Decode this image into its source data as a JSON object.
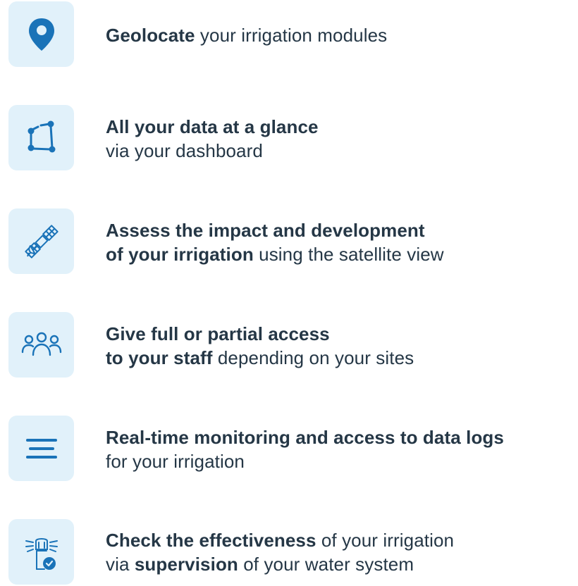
{
  "features": [
    {
      "icon": "location-pin-icon",
      "line1_bold": "Geolocate",
      "line1_rest": " your irrigation modules"
    },
    {
      "icon": "dashboard-nodes-icon",
      "line1_bold": "All your data at a glance",
      "line2_rest": "via your dashboard"
    },
    {
      "icon": "satellite-icon",
      "line1_bold": "Assess the impact and development",
      "line2_bold": "of your irrigation",
      "line2_rest": " using the satellite view"
    },
    {
      "icon": "users-group-icon",
      "line1_bold": "Give full or partial access",
      "line2_bold": "to your staff",
      "line2_rest": " depending on your sites"
    },
    {
      "icon": "menu-lines-icon",
      "line1_bold": "Real-time monitoring and access to data logs",
      "line2_rest": "for your irrigation"
    },
    {
      "icon": "sprinkler-check-icon",
      "line1_bold": "Check the effectiveness",
      "line1_rest": " of your irrigation",
      "line2_pre": "via ",
      "line2_bold": "supervision",
      "line2_rest": " of your water system"
    }
  ],
  "colors": {
    "icon_blue": "#1a73b8",
    "icon_bg": "#e1f1fa",
    "text": "#253746"
  }
}
